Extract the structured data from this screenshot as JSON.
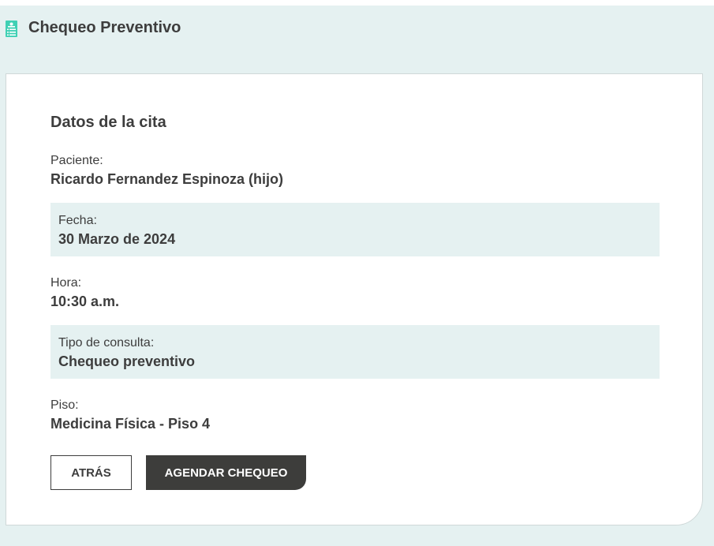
{
  "header": {
    "title": "Chequeo Preventivo",
    "icon": "medical-report-icon",
    "icon_color": "#3fd0b4"
  },
  "appointment": {
    "section_title": "Datos de la cita",
    "fields": [
      {
        "label": "Paciente:",
        "value": "Ricardo Fernandez Espinoza (hijo)"
      },
      {
        "label": "Fecha:",
        "value": "30 Marzo de 2024"
      },
      {
        "label": "Hora:",
        "value": "10:30 a.m."
      },
      {
        "label": "Tipo de consulta:",
        "value": "Chequeo preventivo"
      },
      {
        "label": "Piso:",
        "value": "Medicina Física - Piso 4"
      }
    ]
  },
  "actions": {
    "back_label": "ATRÁS",
    "submit_label": "AGENDAR CHEQUEO"
  },
  "colors": {
    "background": "#e5f1f1",
    "text": "#3d3d3d",
    "primary_button": "#3d3d3b"
  }
}
